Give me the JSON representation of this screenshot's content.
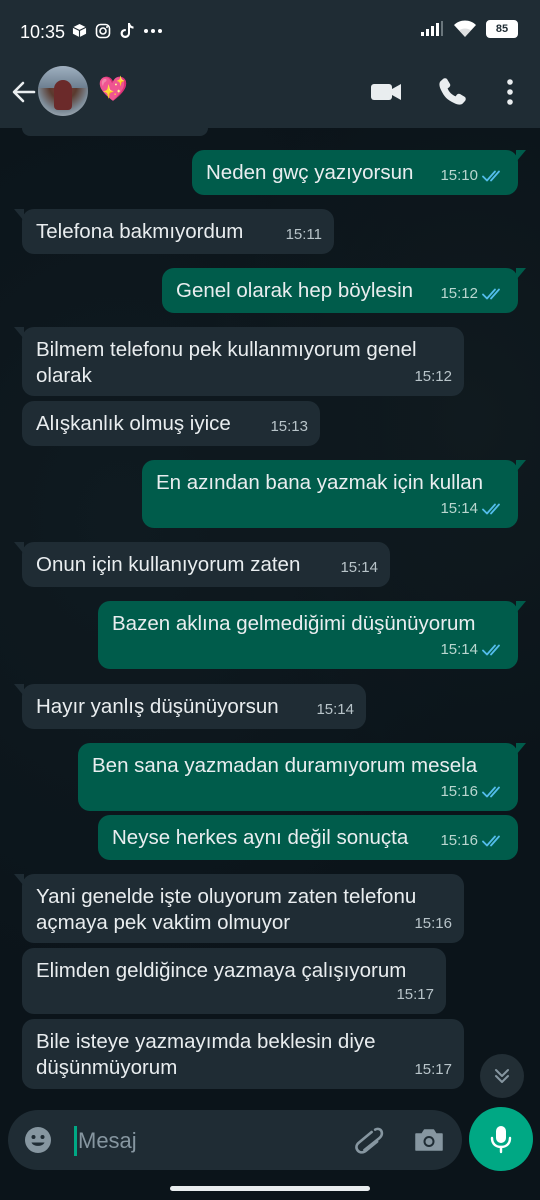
{
  "status_bar": {
    "time": "10:35",
    "battery": "85"
  },
  "header": {
    "contact_emoji": "💖"
  },
  "messages": [
    {
      "dir": "out",
      "text": "Neden gwç yazıyorsun",
      "time": "15:10"
    },
    {
      "dir": "in",
      "text": "Telefona bakmıyordum",
      "time": "15:11"
    },
    {
      "dir": "out",
      "text": "Genel olarak hep böylesin",
      "time": "15:12"
    },
    {
      "dir": "in",
      "text": "Bilmem telefonu pek kullanmıyorum genel olarak",
      "time": "15:12"
    },
    {
      "dir": "in",
      "text": "Alışkanlık olmuş iyice",
      "time": "15:13"
    },
    {
      "dir": "out",
      "text": "En azından bana yazmak için kullan",
      "time": "15:14"
    },
    {
      "dir": "in",
      "text": "Onun için kullanıyorum zaten",
      "time": "15:14"
    },
    {
      "dir": "out",
      "text": "Bazen aklına gelmediğimi düşünüyorum",
      "time": "15:14"
    },
    {
      "dir": "in",
      "text": "Hayır yanlış düşünüyorsun",
      "time": "15:14"
    },
    {
      "dir": "out",
      "text": "Ben sana yazmadan duramıyorum mesela",
      "time": "15:16"
    },
    {
      "dir": "out",
      "text": "Neyse herkes aynı değil sonuçta",
      "time": "15:16"
    },
    {
      "dir": "in",
      "text": "Yani genelde işte oluyorum zaten telefonu açmaya pek vaktim olmuyor",
      "time": "15:16"
    },
    {
      "dir": "in",
      "text": "Elimden geldiğince yazmaya çalışıyorum",
      "time": "15:17"
    },
    {
      "dir": "in",
      "text": "Bile isteye yazmayımda beklesin diye düşünmüyorum",
      "time": "15:17"
    }
  ],
  "composer": {
    "placeholder": "Mesaj"
  },
  "colors": {
    "accent": "#00a884",
    "outgoing_bubble": "#005c4b",
    "incoming_bubble": "#1f2c34",
    "read_ticks": "#53bdeb"
  }
}
